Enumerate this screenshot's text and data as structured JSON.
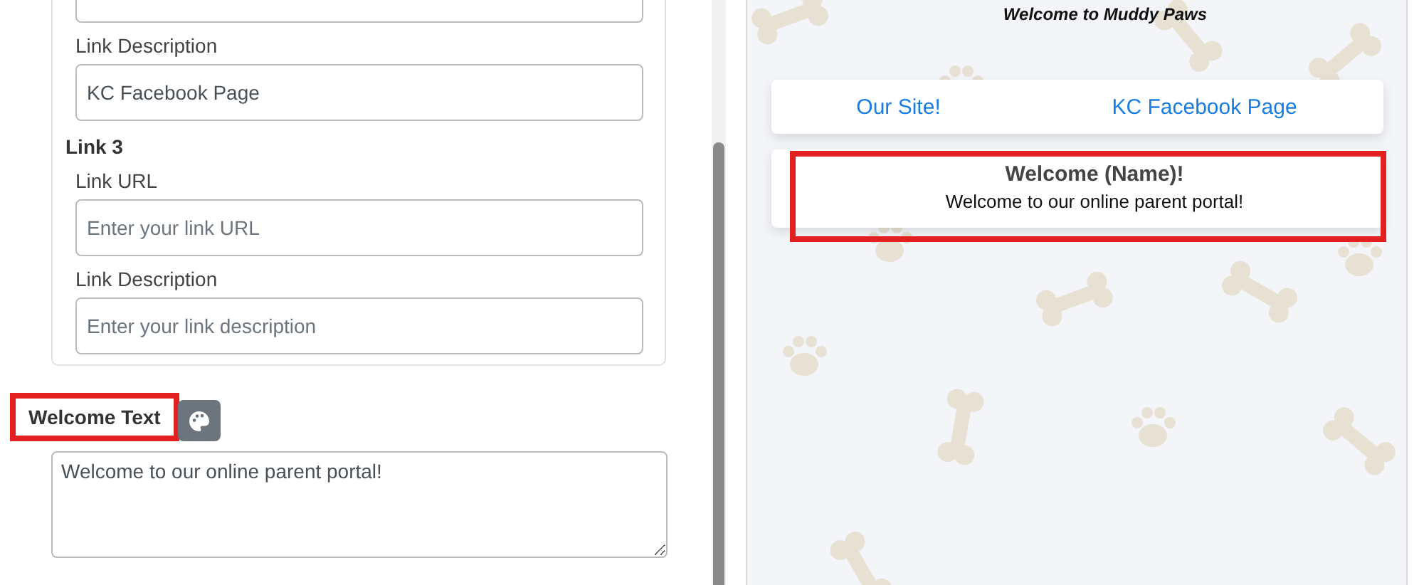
{
  "editor": {
    "link_2_description": {
      "label": "Link Description",
      "value": "KC Facebook Page"
    },
    "link_3": {
      "heading": "Link 3",
      "fields": [
        {
          "label": "Link URL",
          "placeholder": "Enter your link URL"
        },
        {
          "label": "Link Description",
          "placeholder": "Enter your link description"
        }
      ]
    },
    "welcome_text": {
      "label": "Welcome Text",
      "highlighted": true,
      "value": "Welcome to our online parent portal!"
    }
  },
  "preview": {
    "title": "Welcome to Muddy Paws",
    "links": [
      "Our Site!",
      "KC Facebook Page"
    ],
    "welcome_card": {
      "heading": "Welcome (Name)!",
      "message": "Welcome to our online parent portal!",
      "highlighted": true
    }
  }
}
